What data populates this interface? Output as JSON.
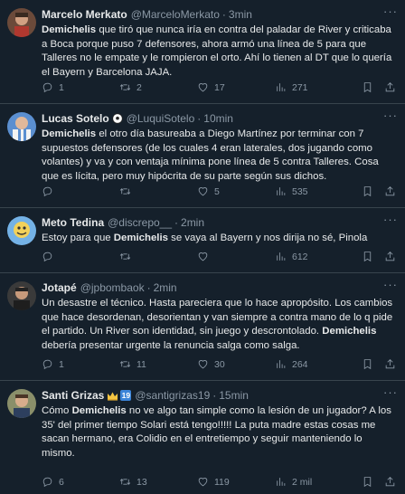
{
  "tweets": [
    {
      "name": "Marcelo Merkato",
      "handle": "@MarceloMerkato",
      "time": "3min",
      "segments": [
        {
          "text": "Demichelis",
          "bold": true
        },
        {
          "text": " que tiró que nunca iría en contra del paladar de River y criticaba a Boca porque puso 7 defensores, ahora armó una línea de 5 para que Talleres no le empate y le rompieron el orto. Ahí lo tienen al DT que lo quería el Bayern y Barcelona JAJA.",
          "bold": false
        }
      ],
      "replies": "1",
      "retweets": "2",
      "likes": "17",
      "views": "271"
    },
    {
      "name": "Lucas Sotelo",
      "handle": "@LuquiSotelo",
      "time": "10min",
      "segments": [
        {
          "text": "Demichelis",
          "bold": true
        },
        {
          "text": " el otro día basureaba a Diego Martínez por terminar con 7 supuestos defensores (de los cuales 4 eran laterales, dos jugando como volantes) y va y con ventaja mínima pone línea de 5 contra Talleres. Cosa que es lícita, pero muy hipócrita de su parte según sus dichos.",
          "bold": false
        }
      ],
      "replies": "",
      "retweets": "",
      "likes": "5",
      "views": "535"
    },
    {
      "name": "Meto Tedina",
      "handle": "@discrepo__",
      "time": "2min",
      "segments": [
        {
          "text": "Estoy para que ",
          "bold": false
        },
        {
          "text": "Demichelis",
          "bold": true
        },
        {
          "text": " se vaya al Bayern y nos dirija no sé, Pinola",
          "bold": false
        }
      ],
      "replies": "",
      "retweets": "",
      "likes": "",
      "views": "612"
    },
    {
      "name": "Jotapé",
      "handle": "@jpbombaok",
      "time": "2min",
      "segments": [
        {
          "text": "Un desastre el técnico. Hasta pareciera que lo hace apropósito. Los cambios que hace desordenan, desorientan y van siempre a contra mano de lo q pide el partido. Un River son identidad, sin juego y descrontolado. ",
          "bold": false
        },
        {
          "text": "Demichelis",
          "bold": true
        },
        {
          "text": " debería presentar urgente la renuncia salga como salga.",
          "bold": false
        }
      ],
      "replies": "1",
      "retweets": "11",
      "likes": "30",
      "views": "264"
    },
    {
      "name": "Santi Grizas",
      "handle": "@santigrizas19",
      "time": "15min",
      "badge_text": "19",
      "segments": [
        {
          "text": "Cómo ",
          "bold": false
        },
        {
          "text": "Demichelis",
          "bold": true
        },
        {
          "text": " no ve algo tan simple como la lesión de un jugador? A los 35' del primer tiempo Solari está tengo!!!!! La puta madre estas cosas me sacan hermano, era Colidio en el entretiempo y seguir manteniendo lo mismo.",
          "bold": false
        }
      ],
      "replies": "6",
      "retweets": "13",
      "likes": "119",
      "views": "2 mil"
    }
  ],
  "ui": {
    "more_glyph": "···"
  }
}
